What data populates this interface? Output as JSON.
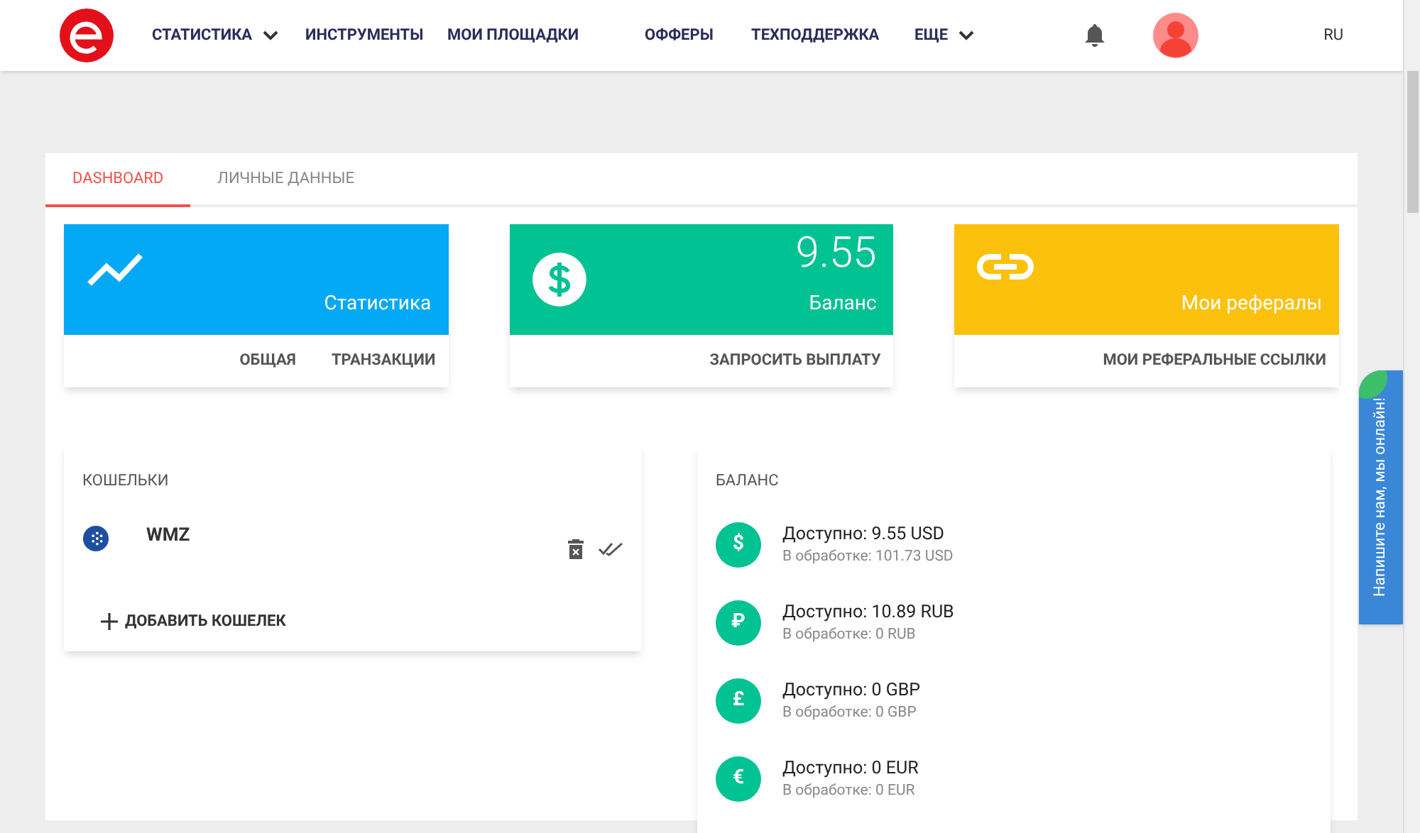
{
  "nav": {
    "items": [
      {
        "label": "СТАТИСТИКА",
        "dropdown": true
      },
      {
        "label": "ИНСТРУМЕНТЫ",
        "dropdown": false
      },
      {
        "label": "МОИ ПЛОЩАДКИ",
        "dropdown": false
      },
      {
        "label": "ОФФЕРЫ",
        "dropdown": false
      },
      {
        "label": "ТЕХПОДДЕРЖКА",
        "dropdown": false
      },
      {
        "label": "ЕЩЕ",
        "dropdown": true
      }
    ],
    "language": "RU"
  },
  "tabs": [
    {
      "label": "DASHBOARD",
      "selected": true
    },
    {
      "label": "ЛИЧНЫЕ ДАННЫЕ",
      "selected": false
    }
  ],
  "tiles": [
    {
      "kind": "chart",
      "color": "#03a9f4",
      "title": "Статистика",
      "links": [
        "ОБЩАЯ",
        "ТРАНЗАКЦИИ"
      ]
    },
    {
      "kind": "dollar",
      "color": "#00c292",
      "value": "9.55",
      "title": "Баланс",
      "links": [
        "ЗАПРОСИТЬ ВЫПЛАТУ"
      ]
    },
    {
      "kind": "link",
      "color": "#fcc10d",
      "title": "Мои рефералы",
      "links": [
        "МОИ РЕФЕРАЛЬНЫЕ ССЫЛКИ"
      ]
    }
  ],
  "wallets": {
    "title": "КОШЕЛЬКИ",
    "items": [
      {
        "name": "WMZ"
      }
    ],
    "add": "ДОБАВИТЬ КОШЕЛЕК"
  },
  "balance": {
    "title": "БАЛАНС",
    "items": [
      {
        "symbol": "$",
        "available": "Доступно: 9.55 USD",
        "pending": "В обработке: 101.73 USD"
      },
      {
        "symbol": "₽",
        "available": "Доступно: 10.89 RUB",
        "pending": "В обработке: 0 RUB"
      },
      {
        "symbol": "£",
        "available": "Доступно: 0 GBP",
        "pending": "В обработке: 0 GBP"
      },
      {
        "symbol": "€",
        "available": "Доступно: 0 EUR",
        "pending": "В обработке: 0 EUR"
      }
    ]
  },
  "chat_tab": "Напишите нам, мы онлайн!"
}
